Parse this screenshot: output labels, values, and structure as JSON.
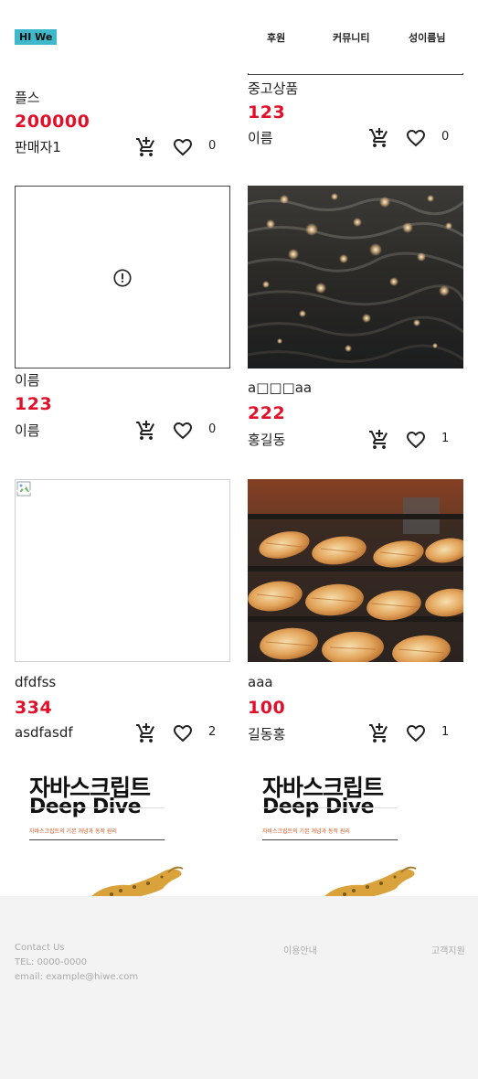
{
  "header": {
    "logo": "HI We",
    "nav": [
      "후원",
      "커뮤니티",
      "성이름님"
    ]
  },
  "cards": [
    {
      "title": "플스",
      "price": "200000",
      "seller": "판매자1",
      "likes": "0"
    },
    {
      "title": "중고상품",
      "price": "123",
      "seller": "이름",
      "likes": "0"
    },
    {
      "title": "이름",
      "price": "123",
      "seller": "이름",
      "likes": "0"
    },
    {
      "title": "a□□□aa",
      "price": "222",
      "seller": "홍길동",
      "likes": "1"
    },
    {
      "title": "dfdfss",
      "price": "334",
      "seller": "asdfasdf",
      "likes": "2"
    },
    {
      "title": "aaa",
      "price": "100",
      "seller": "길동홍",
      "likes": "1"
    }
  ],
  "book": {
    "title_line1": "자바스크립트",
    "title_line2": "Deep Dive",
    "subtitle": "자바스크립트의 기본 개념과 동작 원리"
  },
  "footer": {
    "contact_title": "Contact Us",
    "tel": "TEL: 0000-0000",
    "email": "email: example@hiwe.com",
    "guide": "이용안내",
    "support": "고객지원"
  },
  "colors": {
    "accent": "#e0102a",
    "logo_bg": "#3fb8c9",
    "footer_bg": "#f3f3f3"
  }
}
